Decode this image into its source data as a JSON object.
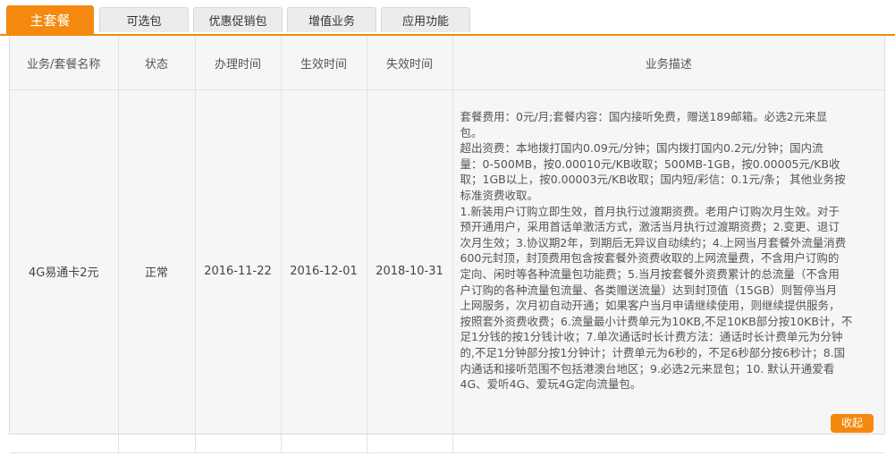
{
  "tabs": [
    {
      "label": "主套餐",
      "active": true
    },
    {
      "label": "可选包",
      "active": false
    },
    {
      "label": "优惠促销包",
      "active": false
    },
    {
      "label": "增值业务",
      "active": false
    },
    {
      "label": "应用功能",
      "active": false
    }
  ],
  "accent_color": "#f5890f",
  "table": {
    "headers": [
      "业务/套餐名称",
      "状态",
      "办理时间",
      "生效时间",
      "失效时间",
      "业务描述"
    ],
    "row": {
      "name": "4G易通卡2元",
      "status": "正常",
      "apply_date": "2016-11-22",
      "effective_date": "2016-12-01",
      "expire_date": "2018-10-31",
      "description_lines": [
        "套餐费用：0元/月;套餐内容：国内接听免费，赠送189邮箱。必选2元来显",
        "包。",
        "超出资费：本地拨打国内0.09元/分钟；国内拨打国内0.2元/分钟；国内流",
        "量：0-500MB，按0.00010元/KB收取；500MB-1GB，按0.00005元/KB收",
        "取；1GB以上，按0.00003元/KB收取；国内短/彩信：0.1元/条； 其他业务按",
        "标准资费收取。",
        "1.新装用户订购立即生效，首月执行过渡期资费。老用户订购次月生效。对于",
        "预开通用户，采用首话单激活方式，激活当月执行过渡期资费；2.变更、退订",
        "次月生效；3.协议期2年，到期后无异议自动续约；4.上网当月套餐外流量消费",
        "600元封顶，封顶费用包含按套餐外资费收取的上网流量费，不含用户订购的",
        "定向、闲时等各种流量包功能费；5.当月按套餐外资费累计的总流量（不含用",
        "户订购的各种流量包流量、各类赠送流量）达到封顶值（15GB）则暂停当月",
        "上网服务，次月初自动开通；如果客户当月申请继续使用，则继续提供服务，",
        "按照套外资费收费；6.流量最小计费单元为10KB,不足10KB部分按10KB计，不",
        "足1分钱的按1分钱计收；7.单次通话时长计费方法：通话时长计费单元为分钟",
        "的,不足1分钟部分按1分钟计；计费单元为6秒的，不足6秒部分按6秒计；8.国",
        "内通话和接听范围不包括港澳台地区；9.必选2元来显包；10. 默认开通爱看",
        "4G、爱听4G、爱玩4G定向流量包。"
      ],
      "collapse_label": "收起"
    }
  }
}
